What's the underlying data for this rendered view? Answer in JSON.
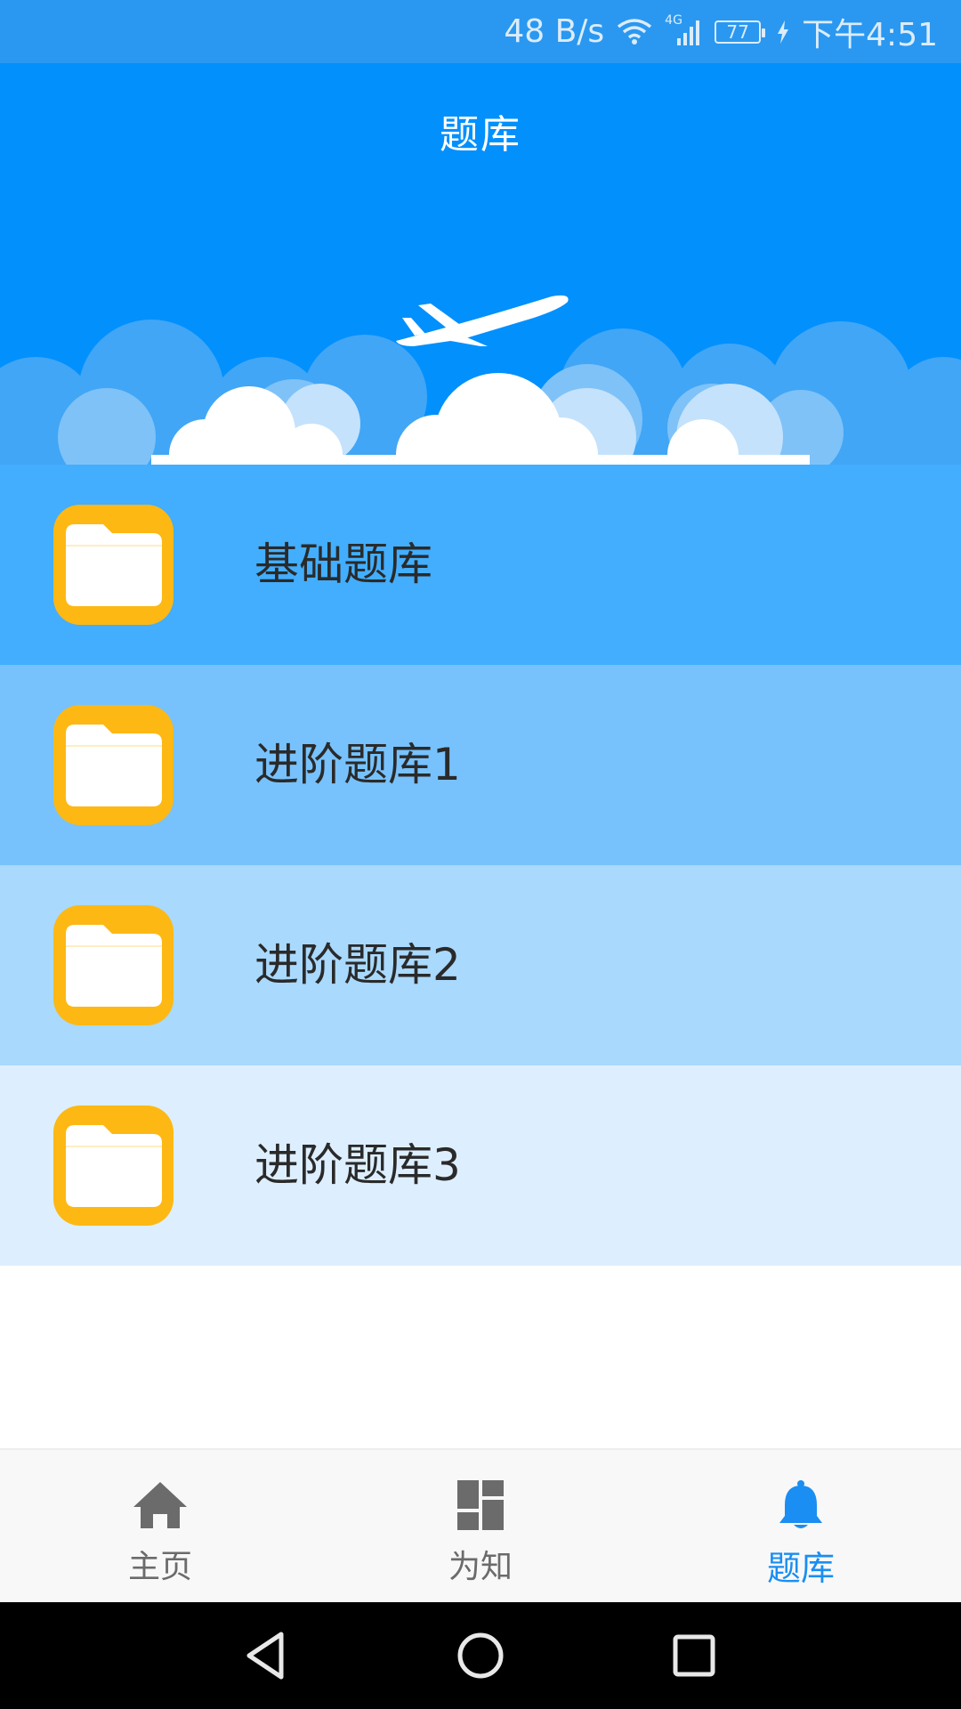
{
  "status_bar": {
    "net_speed": "48 B/s",
    "network_type": "4G",
    "battery": "77",
    "time": "下午4:51",
    "icons": [
      "wifi-icon",
      "signal-icon",
      "battery-icon",
      "charging-icon"
    ]
  },
  "header": {
    "title": "题库",
    "background_color": "#0290fd"
  },
  "question_banks": [
    {
      "label": "基础题库",
      "icon": "folder-icon",
      "background": "#42aefd"
    },
    {
      "label": "进阶题库1",
      "icon": "folder-icon",
      "background": "#77c2fc"
    },
    {
      "label": "进阶题库2",
      "icon": "folder-icon",
      "background": "#a9d9fd"
    },
    {
      "label": "进阶题库3",
      "icon": "folder-icon",
      "background": "#ddeffe"
    }
  ],
  "bottom_nav": {
    "tabs": [
      {
        "label": "主页",
        "icon": "home-icon",
        "active": false
      },
      {
        "label": "为知",
        "icon": "dashboard-icon",
        "active": false
      },
      {
        "label": "题库",
        "icon": "bell-icon",
        "active": true
      }
    ],
    "active_color": "#1a8ef2",
    "inactive_color": "#6b6b6b"
  },
  "system_nav": {
    "buttons": [
      "back-icon",
      "home-circle-icon",
      "recents-icon"
    ]
  }
}
